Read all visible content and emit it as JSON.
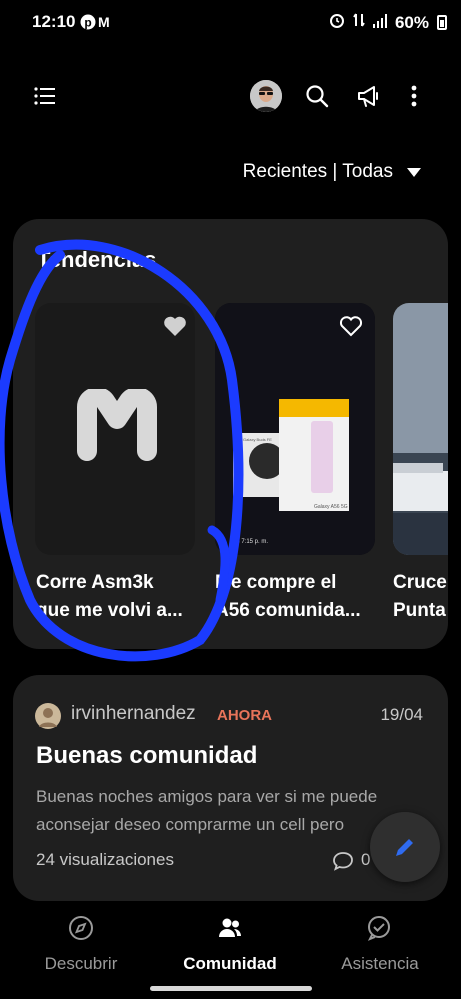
{
  "status_bar": {
    "time": "12:10",
    "battery": "60%",
    "notif_app_letter": "M"
  },
  "top_bar": {
    "menu_icon": "menu-list-icon",
    "search_icon": "search-icon",
    "announce_icon": "megaphone-icon",
    "more_icon": "more-vert-icon"
  },
  "filter": {
    "label": "Recientes | Todas"
  },
  "trending": {
    "title": "Tendencias",
    "items": [
      {
        "line1": "Corre Asm3k",
        "line2": "que me volvi a...",
        "logo_letter": "M"
      },
      {
        "line1": "Me compre el",
        "line2": "A56 comunida...",
        "box_label": "Galaxy A56 5G",
        "buds_label": "Galaxy Buds FE",
        "stamp": "15 7:15 p. m."
      },
      {
        "line1": "Cruce",
        "line2": "Punta"
      }
    ]
  },
  "post": {
    "username": "irvinhernandez",
    "when": "AHORA",
    "date": "19/04",
    "title": "Buenas comunidad",
    "excerpt": "Buenas noches amigos para ver si me puede aconsejar deseo comprarme un cell pero",
    "views": "24 visualizaciones",
    "comments": "0"
  },
  "bottom_nav": [
    {
      "label": "Descubrir",
      "icon": "compass-icon"
    },
    {
      "label": "Comunidad",
      "icon": "people-icon",
      "active": true
    },
    {
      "label": "Asistencia",
      "icon": "support-chat-icon"
    }
  ],
  "colors": {
    "accent_blue": "#2F6BF0",
    "card_bg": "#1F1F1F",
    "time_orange": "#E8745A",
    "annotation_blue": "#1B3BFF"
  }
}
